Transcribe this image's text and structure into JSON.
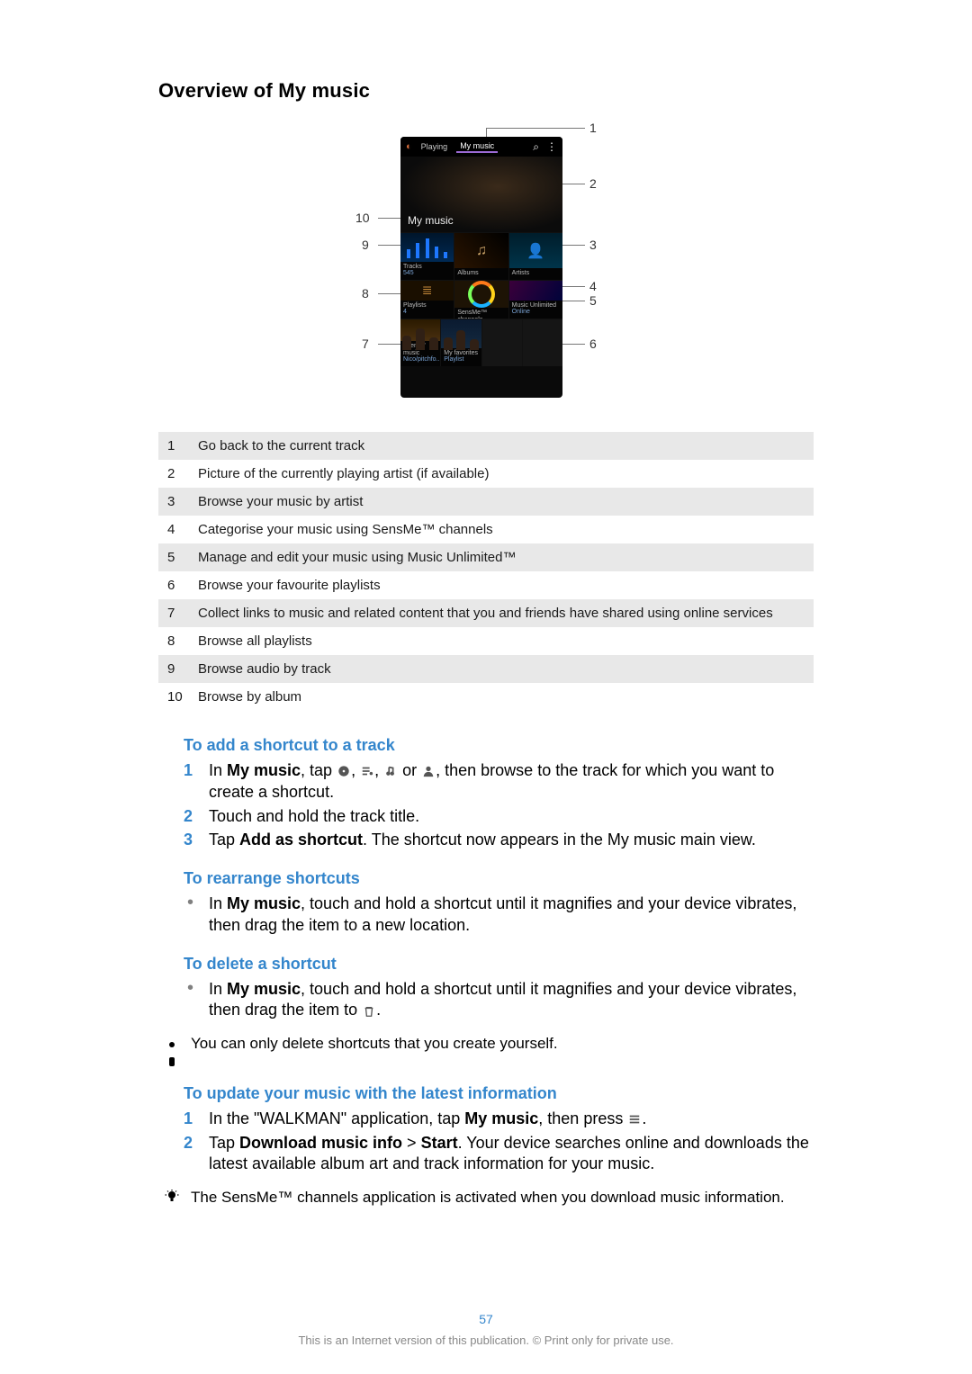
{
  "title": "Overview of My music",
  "diagram": {
    "ui": {
      "tab_playing": "Playing",
      "tab_mymusic": "My music",
      "hero_label": "My music",
      "tiles": {
        "tracks": {
          "label": "Tracks",
          "sub": "545"
        },
        "albums": {
          "label": "Albums",
          "sub": ""
        },
        "artists": {
          "label": "Artists",
          "sub": ""
        },
        "playlists": {
          "label": "Playlists",
          "sub": "4"
        },
        "sensme": {
          "label": "SensMe™ channels",
          "sub": ""
        },
        "unlimited": {
          "label": "Music Unlimited",
          "sub": "Online"
        },
        "friends1": {
          "label": "Friends' music",
          "sub": "Nico/pitchfo..."
        },
        "friends2": {
          "label": "My favorites",
          "sub": "Playlist"
        },
        "fav1": {
          "label": "",
          "sub": ""
        },
        "fav2": {
          "label": "",
          "sub": ""
        }
      }
    },
    "callouts": {
      "n1": "1",
      "n2": "2",
      "n3": "3",
      "n4": "4",
      "n5": "5",
      "n6": "6",
      "n7": "7",
      "n8": "8",
      "n9": "9",
      "n10": "10"
    }
  },
  "legend": [
    {
      "n": "1",
      "t": "Go back to the current track"
    },
    {
      "n": "2",
      "t": "Picture of the currently playing artist (if available)"
    },
    {
      "n": "3",
      "t": "Browse your music by artist"
    },
    {
      "n": "4",
      "t": "Categorise your music using SensMe™ channels"
    },
    {
      "n": "5",
      "t": "Manage and edit your music using Music Unlimited™"
    },
    {
      "n": "6",
      "t": "Browse your favourite playlists"
    },
    {
      "n": "7",
      "t": "Collect links to music and related content that you and friends have shared using online services"
    },
    {
      "n": "8",
      "t": "Browse all playlists"
    },
    {
      "n": "9",
      "t": "Browse audio by track"
    },
    {
      "n": "10",
      "t": "Browse by album"
    }
  ],
  "tasks": {
    "add": {
      "title": "To add a shortcut to a track",
      "s1a": "In ",
      "s1b": "My music",
      "s1c": ", tap ",
      "s1d": ", ",
      "s1e": ", ",
      "s1f": " or ",
      "s1g": ", then browse to the track for which you want to create a shortcut.",
      "s2": "Touch and hold the track title.",
      "s3a": "Tap ",
      "s3b": "Add as shortcut",
      "s3c": ". The shortcut now appears in the My music main view."
    },
    "rearr": {
      "title": "To rearrange shortcuts",
      "b1a": "In ",
      "b1b": "My music",
      "b1c": ", touch and hold a shortcut until it magnifies and your device vibrates, then drag the item to a new location."
    },
    "del": {
      "title": "To delete a shortcut",
      "b1a": "In ",
      "b1b": "My music",
      "b1c": ", touch and hold a shortcut until it magnifies and your device vibrates, then drag the item to ",
      "b1d": ".",
      "note": "You can only delete shortcuts that you create yourself."
    },
    "update": {
      "title": "To update your music with the latest information",
      "s1a": "In the \"WALKMAN\" application, tap ",
      "s1b": "My music",
      "s1c": ", then press ",
      "s1d": ".",
      "s2a": "Tap ",
      "s2b": "Download music info",
      "s2c": " > ",
      "s2d": "Start",
      "s2e": ". Your device searches online and downloads the latest available album art and track information for your music.",
      "tip": "The SensMe™ channels application is activated when you download music information."
    }
  },
  "steps_num": {
    "n1": "1",
    "n2": "2",
    "n3": "3"
  },
  "footer": {
    "page_number": "57",
    "copyright": "This is an Internet version of this publication. © Print only for private use."
  }
}
